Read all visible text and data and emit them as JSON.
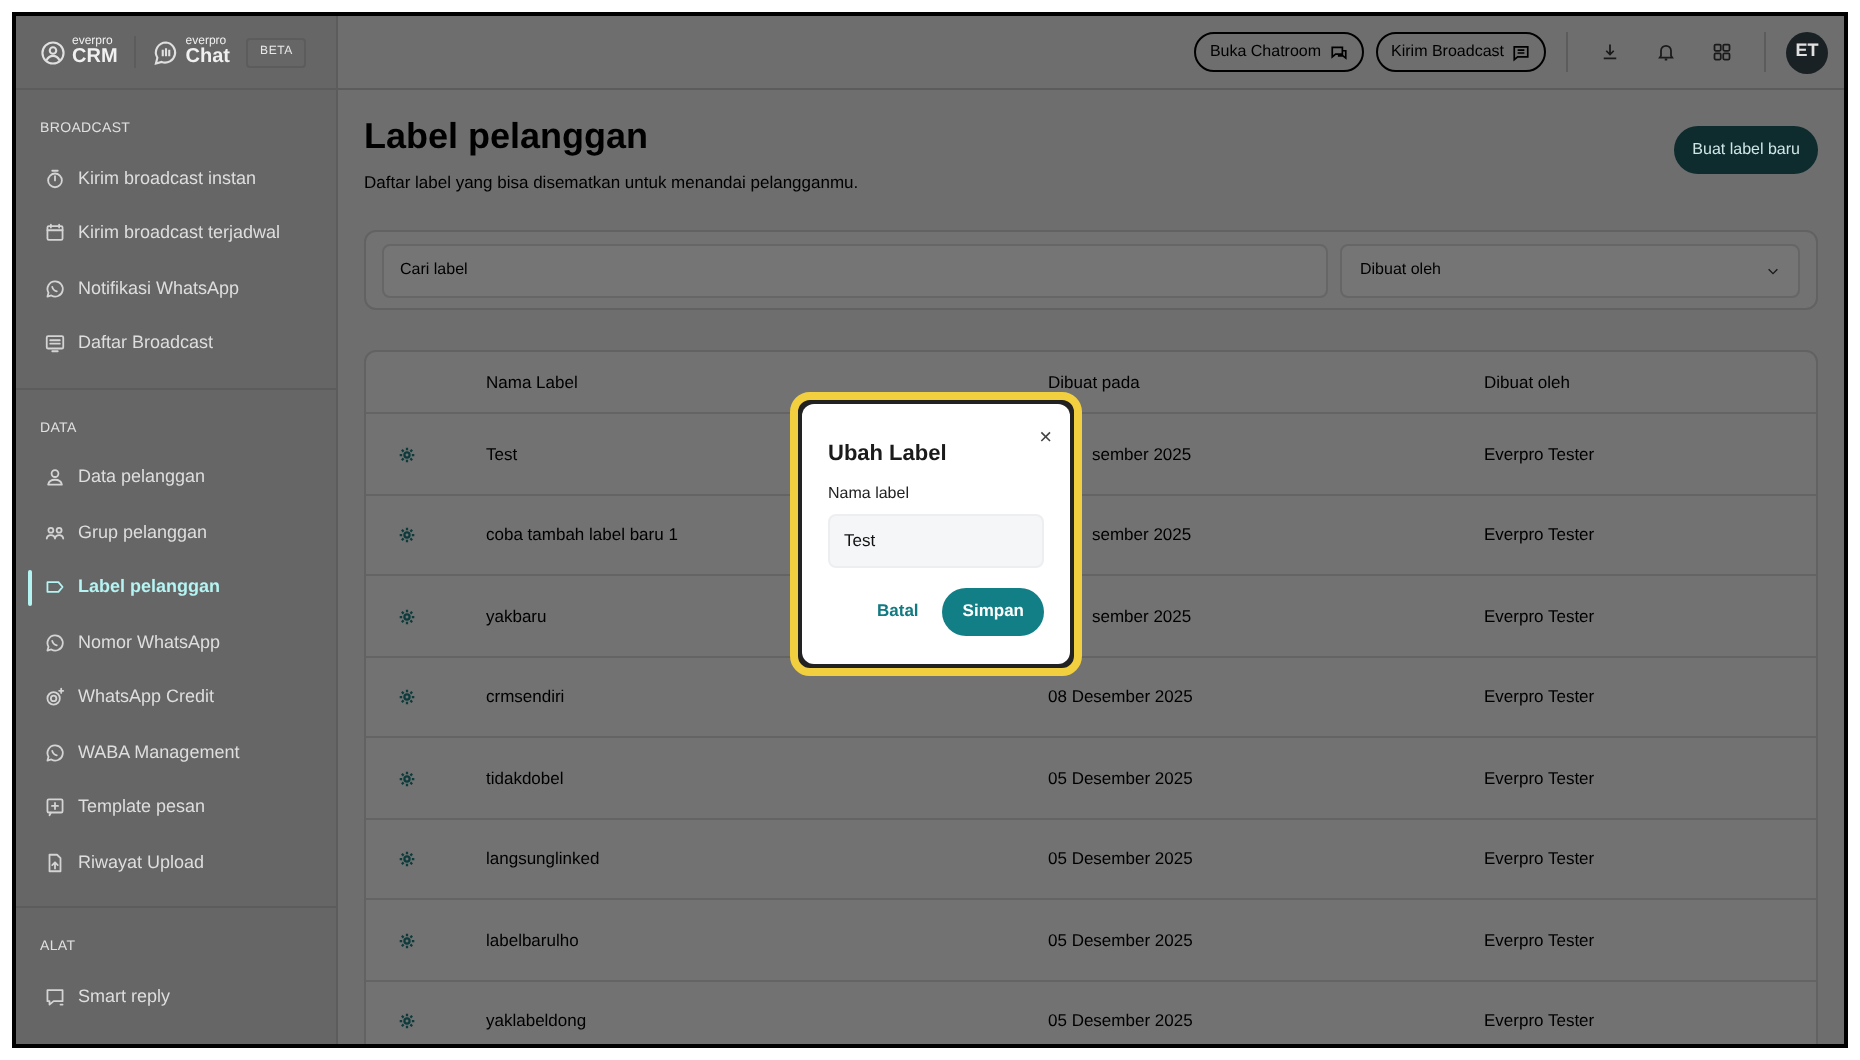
{
  "brand": {
    "logos": [
      {
        "kind": "crm",
        "tag": "everpro",
        "text": "CRM"
      },
      {
        "kind": "chat",
        "tag": "everpro",
        "text": "Chat"
      }
    ],
    "badge": "BETA"
  },
  "sidebar": {
    "sections": [
      {
        "title": "BROADCAST",
        "items": [
          {
            "label": "Kirim broadcast instan",
            "selected": false
          },
          {
            "label": "Kirim broadcast terjadwal",
            "selected": false
          },
          {
            "label": "Notifikasi WhatsApp",
            "selected": false
          },
          {
            "label": "Daftar Broadcast",
            "selected": false
          }
        ]
      },
      {
        "title": "DATA",
        "items": [
          {
            "label": "Data pelanggan",
            "selected": false
          },
          {
            "label": "Grup pelanggan",
            "selected": false
          },
          {
            "label": "Label pelanggan",
            "selected": true
          },
          {
            "label": "Nomor WhatsApp",
            "selected": false
          },
          {
            "label": "WhatsApp Credit",
            "selected": false
          },
          {
            "label": "WABA Management",
            "selected": false
          },
          {
            "label": "Template pesan",
            "selected": false
          },
          {
            "label": "Riwayat Upload",
            "selected": false
          }
        ]
      },
      {
        "title": "ALAT",
        "items": [
          {
            "label": "Smart reply",
            "selected": false
          }
        ]
      }
    ]
  },
  "header": {
    "buttons": [
      "Buka Chatroom",
      "Kirim Broadcast"
    ],
    "avatar": "ET"
  },
  "page": {
    "title": "Label pelanggan",
    "subtitle": "Daftar label yang bisa disematkan untuk menandai pelangganmu.",
    "create_button": "Buat label baru"
  },
  "filters": {
    "search": {
      "placeholder": "Cari label"
    },
    "dropdown": {
      "placeholder": "Dibuat oleh"
    }
  },
  "table": {
    "columns": [
      "Nama Label",
      "Dibuat pada",
      "Dibuat oleh"
    ],
    "rows": [
      [
        "Test",
        "sember 2025",
        "Everpro Tester"
      ],
      [
        "coba tambah label baru 1",
        "sember 2025",
        "Everpro Tester"
      ],
      [
        "yakbaru",
        "sember 2025",
        "Everpro Tester"
      ],
      [
        "crmsendiri",
        "08 Desember 2025",
        "Everpro Tester"
      ],
      [
        "tidakdobel",
        "05 Desember 2025",
        "Everpro Tester"
      ],
      [
        "langsunglinked",
        "05 Desember 2025",
        "Everpro Tester"
      ],
      [
        "labelbarulho",
        "05 Desember 2025",
        "Everpro Tester"
      ],
      [
        "yaklabeldong",
        "05 Desember 2025",
        "Everpro Tester"
      ]
    ]
  },
  "dialog": {
    "title": "Ubah Label",
    "close": "×",
    "field_label": "Nama label",
    "value": "Test",
    "buttons": {
      "cancel": "Batal",
      "save": "Simpan"
    }
  }
}
